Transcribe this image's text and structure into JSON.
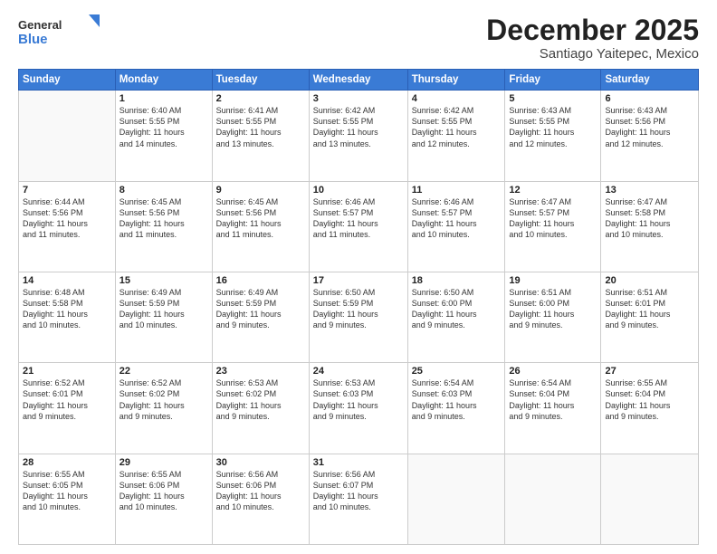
{
  "logo": {
    "general": "General",
    "blue": "Blue"
  },
  "title": "December 2025",
  "location": "Santiago Yaitepec, Mexico",
  "days_header": [
    "Sunday",
    "Monday",
    "Tuesday",
    "Wednesday",
    "Thursday",
    "Friday",
    "Saturday"
  ],
  "weeks": [
    [
      {
        "day": "",
        "info": ""
      },
      {
        "day": "1",
        "info": "Sunrise: 6:40 AM\nSunset: 5:55 PM\nDaylight: 11 hours\nand 14 minutes."
      },
      {
        "day": "2",
        "info": "Sunrise: 6:41 AM\nSunset: 5:55 PM\nDaylight: 11 hours\nand 13 minutes."
      },
      {
        "day": "3",
        "info": "Sunrise: 6:42 AM\nSunset: 5:55 PM\nDaylight: 11 hours\nand 13 minutes."
      },
      {
        "day": "4",
        "info": "Sunrise: 6:42 AM\nSunset: 5:55 PM\nDaylight: 11 hours\nand 12 minutes."
      },
      {
        "day": "5",
        "info": "Sunrise: 6:43 AM\nSunset: 5:55 PM\nDaylight: 11 hours\nand 12 minutes."
      },
      {
        "day": "6",
        "info": "Sunrise: 6:43 AM\nSunset: 5:56 PM\nDaylight: 11 hours\nand 12 minutes."
      }
    ],
    [
      {
        "day": "7",
        "info": "Sunrise: 6:44 AM\nSunset: 5:56 PM\nDaylight: 11 hours\nand 11 minutes."
      },
      {
        "day": "8",
        "info": "Sunrise: 6:45 AM\nSunset: 5:56 PM\nDaylight: 11 hours\nand 11 minutes."
      },
      {
        "day": "9",
        "info": "Sunrise: 6:45 AM\nSunset: 5:56 PM\nDaylight: 11 hours\nand 11 minutes."
      },
      {
        "day": "10",
        "info": "Sunrise: 6:46 AM\nSunset: 5:57 PM\nDaylight: 11 hours\nand 11 minutes."
      },
      {
        "day": "11",
        "info": "Sunrise: 6:46 AM\nSunset: 5:57 PM\nDaylight: 11 hours\nand 10 minutes."
      },
      {
        "day": "12",
        "info": "Sunrise: 6:47 AM\nSunset: 5:57 PM\nDaylight: 11 hours\nand 10 minutes."
      },
      {
        "day": "13",
        "info": "Sunrise: 6:47 AM\nSunset: 5:58 PM\nDaylight: 11 hours\nand 10 minutes."
      }
    ],
    [
      {
        "day": "14",
        "info": "Sunrise: 6:48 AM\nSunset: 5:58 PM\nDaylight: 11 hours\nand 10 minutes."
      },
      {
        "day": "15",
        "info": "Sunrise: 6:49 AM\nSunset: 5:59 PM\nDaylight: 11 hours\nand 10 minutes."
      },
      {
        "day": "16",
        "info": "Sunrise: 6:49 AM\nSunset: 5:59 PM\nDaylight: 11 hours\nand 9 minutes."
      },
      {
        "day": "17",
        "info": "Sunrise: 6:50 AM\nSunset: 5:59 PM\nDaylight: 11 hours\nand 9 minutes."
      },
      {
        "day": "18",
        "info": "Sunrise: 6:50 AM\nSunset: 6:00 PM\nDaylight: 11 hours\nand 9 minutes."
      },
      {
        "day": "19",
        "info": "Sunrise: 6:51 AM\nSunset: 6:00 PM\nDaylight: 11 hours\nand 9 minutes."
      },
      {
        "day": "20",
        "info": "Sunrise: 6:51 AM\nSunset: 6:01 PM\nDaylight: 11 hours\nand 9 minutes."
      }
    ],
    [
      {
        "day": "21",
        "info": "Sunrise: 6:52 AM\nSunset: 6:01 PM\nDaylight: 11 hours\nand 9 minutes."
      },
      {
        "day": "22",
        "info": "Sunrise: 6:52 AM\nSunset: 6:02 PM\nDaylight: 11 hours\nand 9 minutes."
      },
      {
        "day": "23",
        "info": "Sunrise: 6:53 AM\nSunset: 6:02 PM\nDaylight: 11 hours\nand 9 minutes."
      },
      {
        "day": "24",
        "info": "Sunrise: 6:53 AM\nSunset: 6:03 PM\nDaylight: 11 hours\nand 9 minutes."
      },
      {
        "day": "25",
        "info": "Sunrise: 6:54 AM\nSunset: 6:03 PM\nDaylight: 11 hours\nand 9 minutes."
      },
      {
        "day": "26",
        "info": "Sunrise: 6:54 AM\nSunset: 6:04 PM\nDaylight: 11 hours\nand 9 minutes."
      },
      {
        "day": "27",
        "info": "Sunrise: 6:55 AM\nSunset: 6:04 PM\nDaylight: 11 hours\nand 9 minutes."
      }
    ],
    [
      {
        "day": "28",
        "info": "Sunrise: 6:55 AM\nSunset: 6:05 PM\nDaylight: 11 hours\nand 10 minutes."
      },
      {
        "day": "29",
        "info": "Sunrise: 6:55 AM\nSunset: 6:06 PM\nDaylight: 11 hours\nand 10 minutes."
      },
      {
        "day": "30",
        "info": "Sunrise: 6:56 AM\nSunset: 6:06 PM\nDaylight: 11 hours\nand 10 minutes."
      },
      {
        "day": "31",
        "info": "Sunrise: 6:56 AM\nSunset: 6:07 PM\nDaylight: 11 hours\nand 10 minutes."
      },
      {
        "day": "",
        "info": ""
      },
      {
        "day": "",
        "info": ""
      },
      {
        "day": "",
        "info": ""
      }
    ]
  ]
}
